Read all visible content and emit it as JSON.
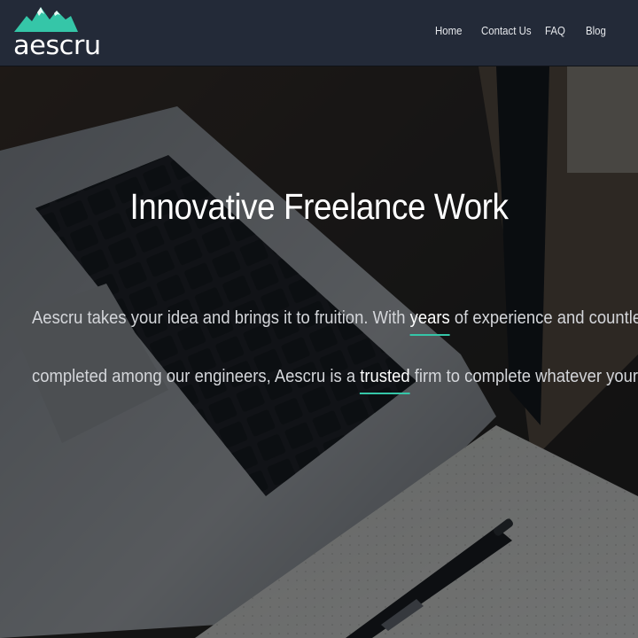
{
  "brand": {
    "name": "aescru",
    "logo_icon": "mountain-logo-icon",
    "accent_color": "#35c6a8"
  },
  "nav": {
    "items": [
      {
        "label": "Home"
      },
      {
        "label": "Contact Us"
      },
      {
        "label": "FAQ"
      },
      {
        "label": "Blog"
      }
    ]
  },
  "hero": {
    "title": "Innovative Freelance Work",
    "line1": {
      "before": "Aescru takes your idea and brings it to fruition. With ",
      "highlight": "years",
      "after": " of experience and countless projects"
    },
    "line2": {
      "before": "completed among our engineers, Aescru is a ",
      "highlight": "trusted",
      "after": " firm to complete whatever your task is."
    },
    "background": "laptop-notebook-pen-photo"
  },
  "colors": {
    "navbar": "#232a38",
    "underline": "#35c6a8",
    "text": "#ffffff"
  }
}
